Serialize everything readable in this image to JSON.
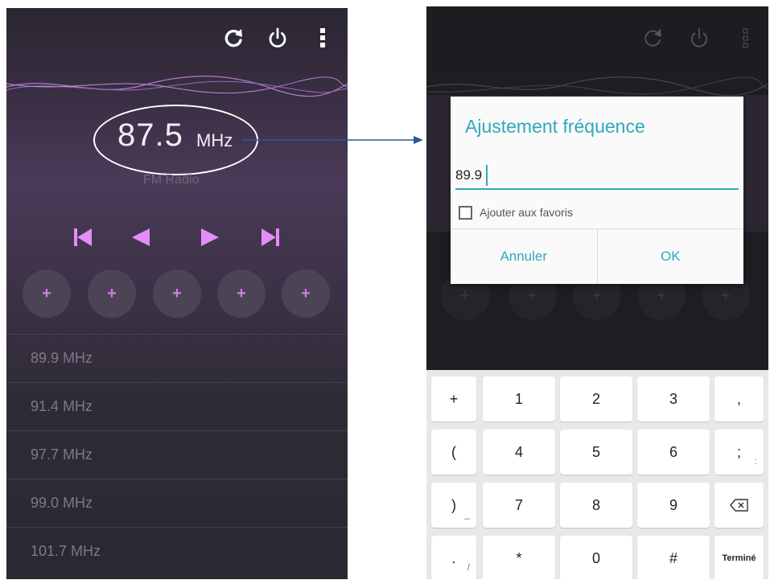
{
  "left_screen": {
    "frequency": "87.5",
    "frequency_unit": "MHz",
    "band": "FM Radio",
    "favorites": [
      "+",
      "+",
      "+",
      "+",
      "+"
    ],
    "stations": [
      "89.9 MHz",
      "91.4 MHz",
      "97.7 MHz",
      "99.0 MHz",
      "101.7 MHz"
    ]
  },
  "dialog": {
    "title": "Ajustement fréquence",
    "input_value": "89.9",
    "favorite_checkbox_label": "Ajouter aux favoris",
    "cancel_label": "Annuler",
    "ok_label": "OK"
  },
  "right_screen": {
    "favorites": [
      "+",
      "+",
      "+",
      "+",
      "+"
    ]
  },
  "keyboard": {
    "rows": [
      [
        "+",
        "1",
        "2",
        "3",
        ","
      ],
      [
        "(",
        "4",
        "5",
        "6",
        ";"
      ],
      [
        ")",
        "7",
        "8",
        "9",
        ""
      ],
      [
        ".",
        "*",
        "0",
        "#",
        "Terminé"
      ]
    ],
    "subs": [
      [
        "",
        "",
        "",
        "",
        ""
      ],
      [
        "",
        "",
        "",
        "",
        ":"
      ],
      [
        "_",
        "",
        "",
        "",
        ""
      ],
      [
        "/",
        "",
        "",
        "",
        ""
      ]
    ]
  },
  "colors": {
    "accent": "#2fa8bc",
    "favorite_plus": "#d47ae8",
    "transport_icons": "#e38ef7"
  }
}
